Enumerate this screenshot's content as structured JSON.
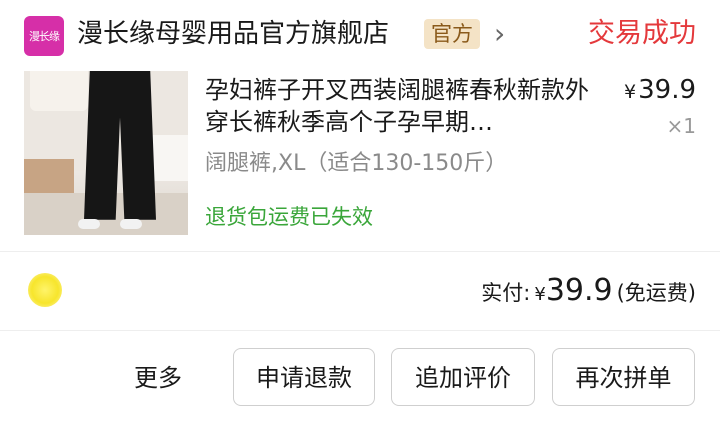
{
  "shop": {
    "logo_text": "漫长缘",
    "name": "漫长缘母婴用品官方旗舰店",
    "official_tag": "官方",
    "chevron": "›",
    "order_status": "交易成功"
  },
  "item": {
    "title": "孕妇裤子开叉西装阔腿裤春秋新款外穿长裤秋季高个子孕早期…",
    "price_symbol": "¥",
    "price": "39.9",
    "quantity": "×1",
    "spec": "阔腿裤,XL（适合130-150斤）",
    "return_note": "退货包运费已失效"
  },
  "payment": {
    "label": "实付:",
    "symbol": "¥",
    "amount": "39.9",
    "shipping_note": "(免运费)"
  },
  "actions": {
    "more": "更多",
    "refund": "申请退款",
    "add_review": "追加评价",
    "reorder": "再次拼单"
  },
  "colors": {
    "status": "#e4393c",
    "return_note": "#3aa63a",
    "official_tag_bg": "#f4e3c6",
    "logo_bg": "#d62fa8"
  }
}
